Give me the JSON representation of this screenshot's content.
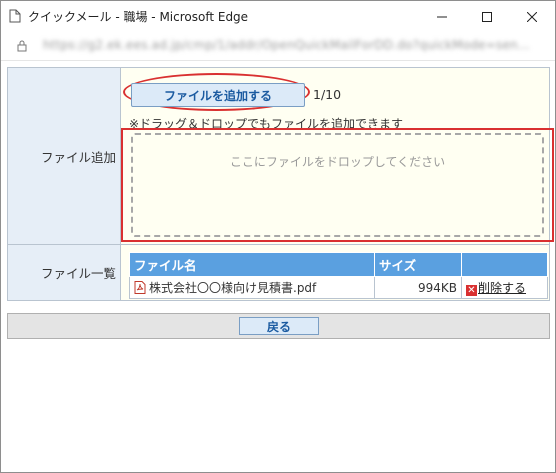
{
  "window": {
    "title": "クイックメール - 職場 - Microsoft Edge",
    "url": "https://g2.ek.ees.ad.jp/cmp/1/addr/OpenQuickMailForDD.do?quickMode=sen..."
  },
  "upload": {
    "row_label": "ファイル追加",
    "add_button_label": "ファイルを追加する",
    "count": "1/10",
    "hint": "※ドラッグ＆ドロップでもファイルを追加できます",
    "dropzone_text": "ここにファイルをドロップしてください"
  },
  "file_list": {
    "row_label": "ファイル一覧",
    "columns": [
      "ファイル名",
      "サイズ",
      ""
    ],
    "rows": [
      {
        "name": "株式会社〇〇様向け見積書.pdf",
        "size": "994KB",
        "action": "削除する"
      }
    ]
  },
  "footer": {
    "back_label": "戻る"
  },
  "colors": {
    "header_blue": "#5aa0e0",
    "highlight_red": "#d93030",
    "label_bg": "#e6eef7",
    "cell_bg": "#fffff2"
  }
}
